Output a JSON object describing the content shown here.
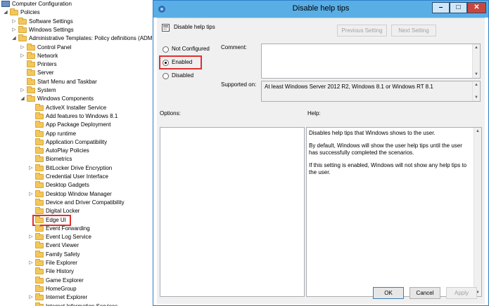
{
  "tree": {
    "items": [
      {
        "label": "Computer Configuration",
        "icon": "computer-icon",
        "expander": "",
        "selected": false
      },
      {
        "label": "Policies",
        "icon": "folder-icon",
        "expander": "expanded",
        "selected": false
      },
      {
        "label": "Software Settings",
        "icon": "folder-icon",
        "expander": "collapsed",
        "selected": false
      },
      {
        "label": "Windows Settings",
        "icon": "folder-icon",
        "expander": "collapsed",
        "selected": false
      },
      {
        "label": "Administrative Templates: Policy definitions (ADM",
        "icon": "folder-icon",
        "expander": "expanded",
        "selected": false
      },
      {
        "label": "Control Panel",
        "icon": "folder-icon",
        "expander": "collapsed",
        "selected": false
      },
      {
        "label": "Network",
        "icon": "folder-icon",
        "expander": "collapsed",
        "selected": false
      },
      {
        "label": "Printers",
        "icon": "folder-icon",
        "expander": "",
        "selected": false
      },
      {
        "label": "Server",
        "icon": "folder-icon",
        "expander": "",
        "selected": false
      },
      {
        "label": "Start Menu and Taskbar",
        "icon": "folder-icon",
        "expander": "",
        "selected": false
      },
      {
        "label": "System",
        "icon": "folder-icon",
        "expander": "collapsed",
        "selected": false
      },
      {
        "label": "Windows Components",
        "icon": "folder-icon",
        "expander": "expanded",
        "selected": false
      },
      {
        "label": "ActiveX Installer Service",
        "icon": "folder-icon",
        "expander": "",
        "selected": false
      },
      {
        "label": "Add features to Windows 8.1",
        "icon": "folder-icon",
        "expander": "",
        "selected": false
      },
      {
        "label": "App Package Deployment",
        "icon": "folder-icon",
        "expander": "",
        "selected": false
      },
      {
        "label": "App runtime",
        "icon": "folder-icon",
        "expander": "",
        "selected": false
      },
      {
        "label": "Application Compatibility",
        "icon": "folder-icon",
        "expander": "",
        "selected": false
      },
      {
        "label": "AutoPlay Policies",
        "icon": "folder-icon",
        "expander": "",
        "selected": false
      },
      {
        "label": "Biometrics",
        "icon": "folder-icon",
        "expander": "",
        "selected": false
      },
      {
        "label": "BitLocker Drive Encryption",
        "icon": "folder-icon",
        "expander": "collapsed",
        "selected": false
      },
      {
        "label": "Credential User Interface",
        "icon": "folder-icon",
        "expander": "",
        "selected": false
      },
      {
        "label": "Desktop Gadgets",
        "icon": "folder-icon",
        "expander": "",
        "selected": false
      },
      {
        "label": "Desktop Window Manager",
        "icon": "folder-icon",
        "expander": "collapsed",
        "selected": false
      },
      {
        "label": "Device and Driver Compatibility",
        "icon": "folder-icon",
        "expander": "",
        "selected": false
      },
      {
        "label": "Digital Locker",
        "icon": "folder-icon",
        "expander": "",
        "selected": false
      },
      {
        "label": "Edge UI",
        "icon": "folder-icon",
        "expander": "",
        "selected": true
      },
      {
        "label": "Event Forwarding",
        "icon": "folder-icon",
        "expander": "",
        "selected": false
      },
      {
        "label": "Event Log Service",
        "icon": "folder-icon",
        "expander": "collapsed",
        "selected": false
      },
      {
        "label": "Event Viewer",
        "icon": "folder-icon",
        "expander": "",
        "selected": false
      },
      {
        "label": "Family Safety",
        "icon": "folder-icon",
        "expander": "",
        "selected": false
      },
      {
        "label": "File Explorer",
        "icon": "folder-icon",
        "expander": "collapsed",
        "selected": false
      },
      {
        "label": "File History",
        "icon": "folder-icon",
        "expander": "",
        "selected": false
      },
      {
        "label": "Game Explorer",
        "icon": "folder-icon",
        "expander": "",
        "selected": false
      },
      {
        "label": "HomeGroup",
        "icon": "folder-icon",
        "expander": "",
        "selected": false
      },
      {
        "label": "Internet Explorer",
        "icon": "folder-icon",
        "expander": "collapsed",
        "selected": false
      },
      {
        "label": "Internet Information Services",
        "icon": "folder-icon",
        "expander": "",
        "selected": false
      }
    ]
  },
  "dialog": {
    "title": "Disable help tips",
    "window_buttons": {
      "minimize": "–",
      "maximize": "□",
      "close": "✕"
    },
    "policy_name": "Disable help tips",
    "previous_setting": "Previous Setting",
    "next_setting": "Next Setting",
    "options": [
      {
        "label": "Not Configured",
        "checked": false
      },
      {
        "label": "Enabled",
        "checked": true
      },
      {
        "label": "Disabled",
        "checked": false
      }
    ],
    "comment_label": "Comment:",
    "comment_value": "",
    "supported_label": "Supported on:",
    "supported_value": "At least Windows Server 2012 R2, Windows 8.1 or Windows RT 8.1",
    "options_label": "Options:",
    "help_label": "Help:",
    "help_paragraphs": [
      "Disables help tips that Windows shows to the user.",
      "By default, Windows will show the user help tips until the user has successfully completed the scenarios.",
      "If this setting is enabled, Windows will not show any help tips to the user."
    ],
    "ok": "OK",
    "cancel": "Cancel",
    "apply": "Apply",
    "highlight_color": "#e03030",
    "titlebar_color": "#5aaee6"
  }
}
